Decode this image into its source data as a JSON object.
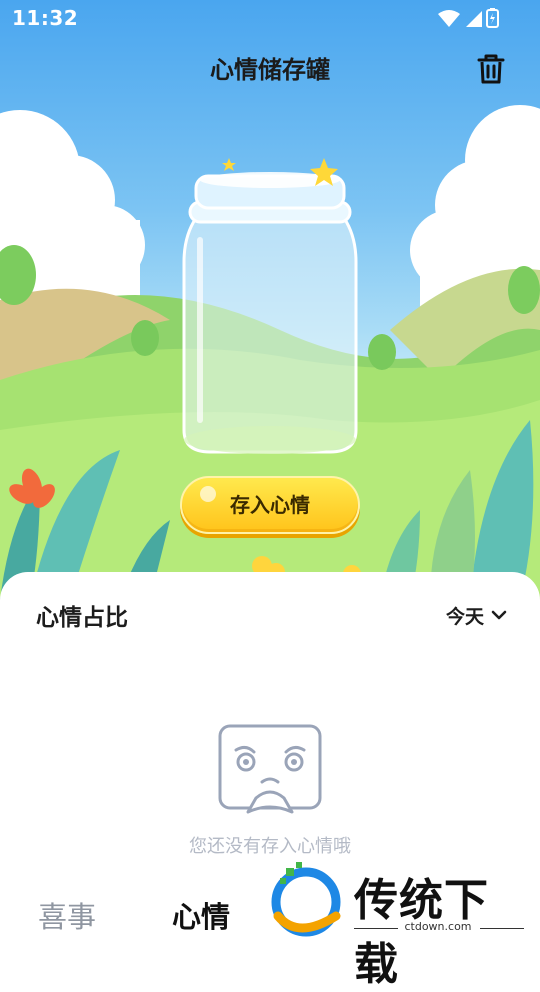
{
  "status_bar": {
    "time": "11:32"
  },
  "header": {
    "title": "心情储存罐"
  },
  "hero": {
    "store_button_label": "存入心情"
  },
  "panel": {
    "title": "心情占比",
    "range_selected": "今天",
    "empty_message": "您还没有存入心情哦"
  },
  "tabs": [
    {
      "label": "喜事",
      "selected": false
    },
    {
      "label": "心情",
      "selected": true
    }
  ],
  "watermark": {
    "title": "传统下载",
    "url": "ctdown.com"
  },
  "colors": {
    "sky_top": "#4aa6ef",
    "button_yellow": "#ffc31a",
    "grass": "#9fe06a",
    "text_dark": "#1d1d1d",
    "text_muted": "#8f96a1"
  },
  "icons": [
    "wifi-icon",
    "signal-icon",
    "battery-icon",
    "trash-icon",
    "chevron-down-icon",
    "sad-face-icon",
    "star-icon"
  ]
}
